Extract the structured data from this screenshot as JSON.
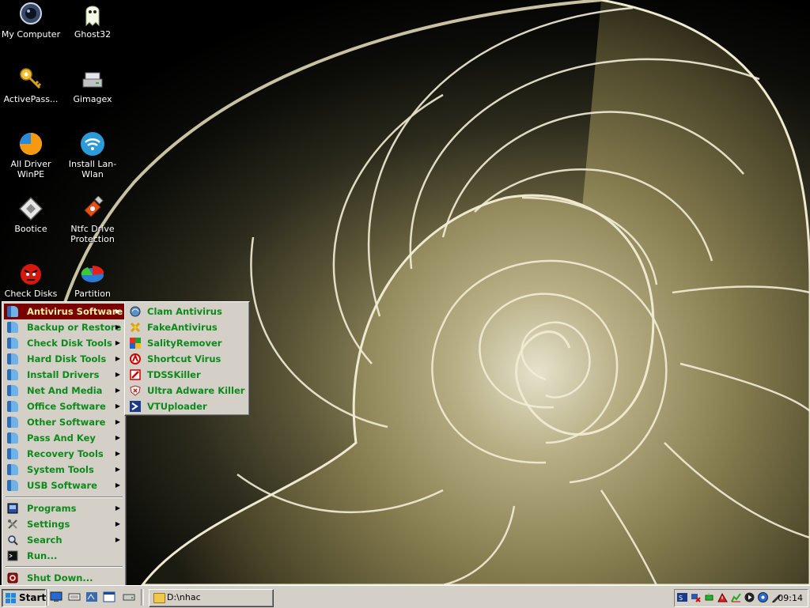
{
  "desktop": {
    "icons": [
      {
        "label": "My Computer",
        "icon": "my-computer-icon"
      },
      {
        "label": "Ghost32",
        "icon": "ghost-icon"
      },
      {
        "label": "ActivePass...",
        "icon": "key-icon"
      },
      {
        "label": "Gimagex",
        "icon": "disk-drive-icon"
      },
      {
        "label": "All Driver WinPE",
        "icon": "pie-chart-icon"
      },
      {
        "label": "Install Lan-Wlan",
        "icon": "wifi-icon"
      },
      {
        "label": "Bootice",
        "icon": "bootice-icon"
      },
      {
        "label": "Ntfc Drive Protection",
        "icon": "usb-drive-icon"
      },
      {
        "label": "Check Disks",
        "icon": "red-face-icon"
      },
      {
        "label": "Partition",
        "icon": "partition-icon"
      }
    ]
  },
  "start_menu": {
    "categories": [
      {
        "label": "Antivirus Software",
        "selected": true
      },
      {
        "label": "Backup or Restore"
      },
      {
        "label": "Check Disk Tools"
      },
      {
        "label": "Hard Disk Tools"
      },
      {
        "label": "Install Drivers"
      },
      {
        "label": "Net And Media"
      },
      {
        "label": "Office Software"
      },
      {
        "label": "Other Software"
      },
      {
        "label": "Pass And Key"
      },
      {
        "label": "Recovery Tools"
      },
      {
        "label": "System Tools"
      },
      {
        "label": "USB Software"
      }
    ],
    "system_items": [
      {
        "label": "Programs",
        "icon": "programs-icon",
        "has_submenu": true
      },
      {
        "label": "Settings",
        "icon": "settings-icon",
        "has_submenu": true
      },
      {
        "label": "Search",
        "icon": "search-icon",
        "has_submenu": true
      },
      {
        "label": "Run...",
        "icon": "run-icon",
        "has_submenu": false
      }
    ],
    "shutdown": {
      "label": "Shut Down...",
      "icon": "shutdown-icon"
    }
  },
  "submenu": {
    "items": [
      {
        "label": "Clam Antivirus",
        "icon": "clam-antivirus-icon"
      },
      {
        "label": "FakeAntivirus",
        "icon": "fake-antivirus-icon"
      },
      {
        "label": "SalityRemover",
        "icon": "sality-remover-icon"
      },
      {
        "label": "Shortcut Virus",
        "icon": "shortcut-virus-icon"
      },
      {
        "label": "TDSSKiller",
        "icon": "tdsskiller-icon"
      },
      {
        "label": "Ultra Adware Killer",
        "icon": "adware-killer-icon"
      },
      {
        "label": "VTUploader",
        "icon": "vtuploader-icon"
      }
    ]
  },
  "taskbar": {
    "start_label": "Start",
    "task_button_label": "D:\\nhac",
    "clock": "09:14"
  },
  "colors": {
    "menu_bg": "#d4d0c8",
    "menu_text": "#0c8a1a",
    "selected_bg": "#7a0000",
    "selected_text": "#fff0a0"
  }
}
